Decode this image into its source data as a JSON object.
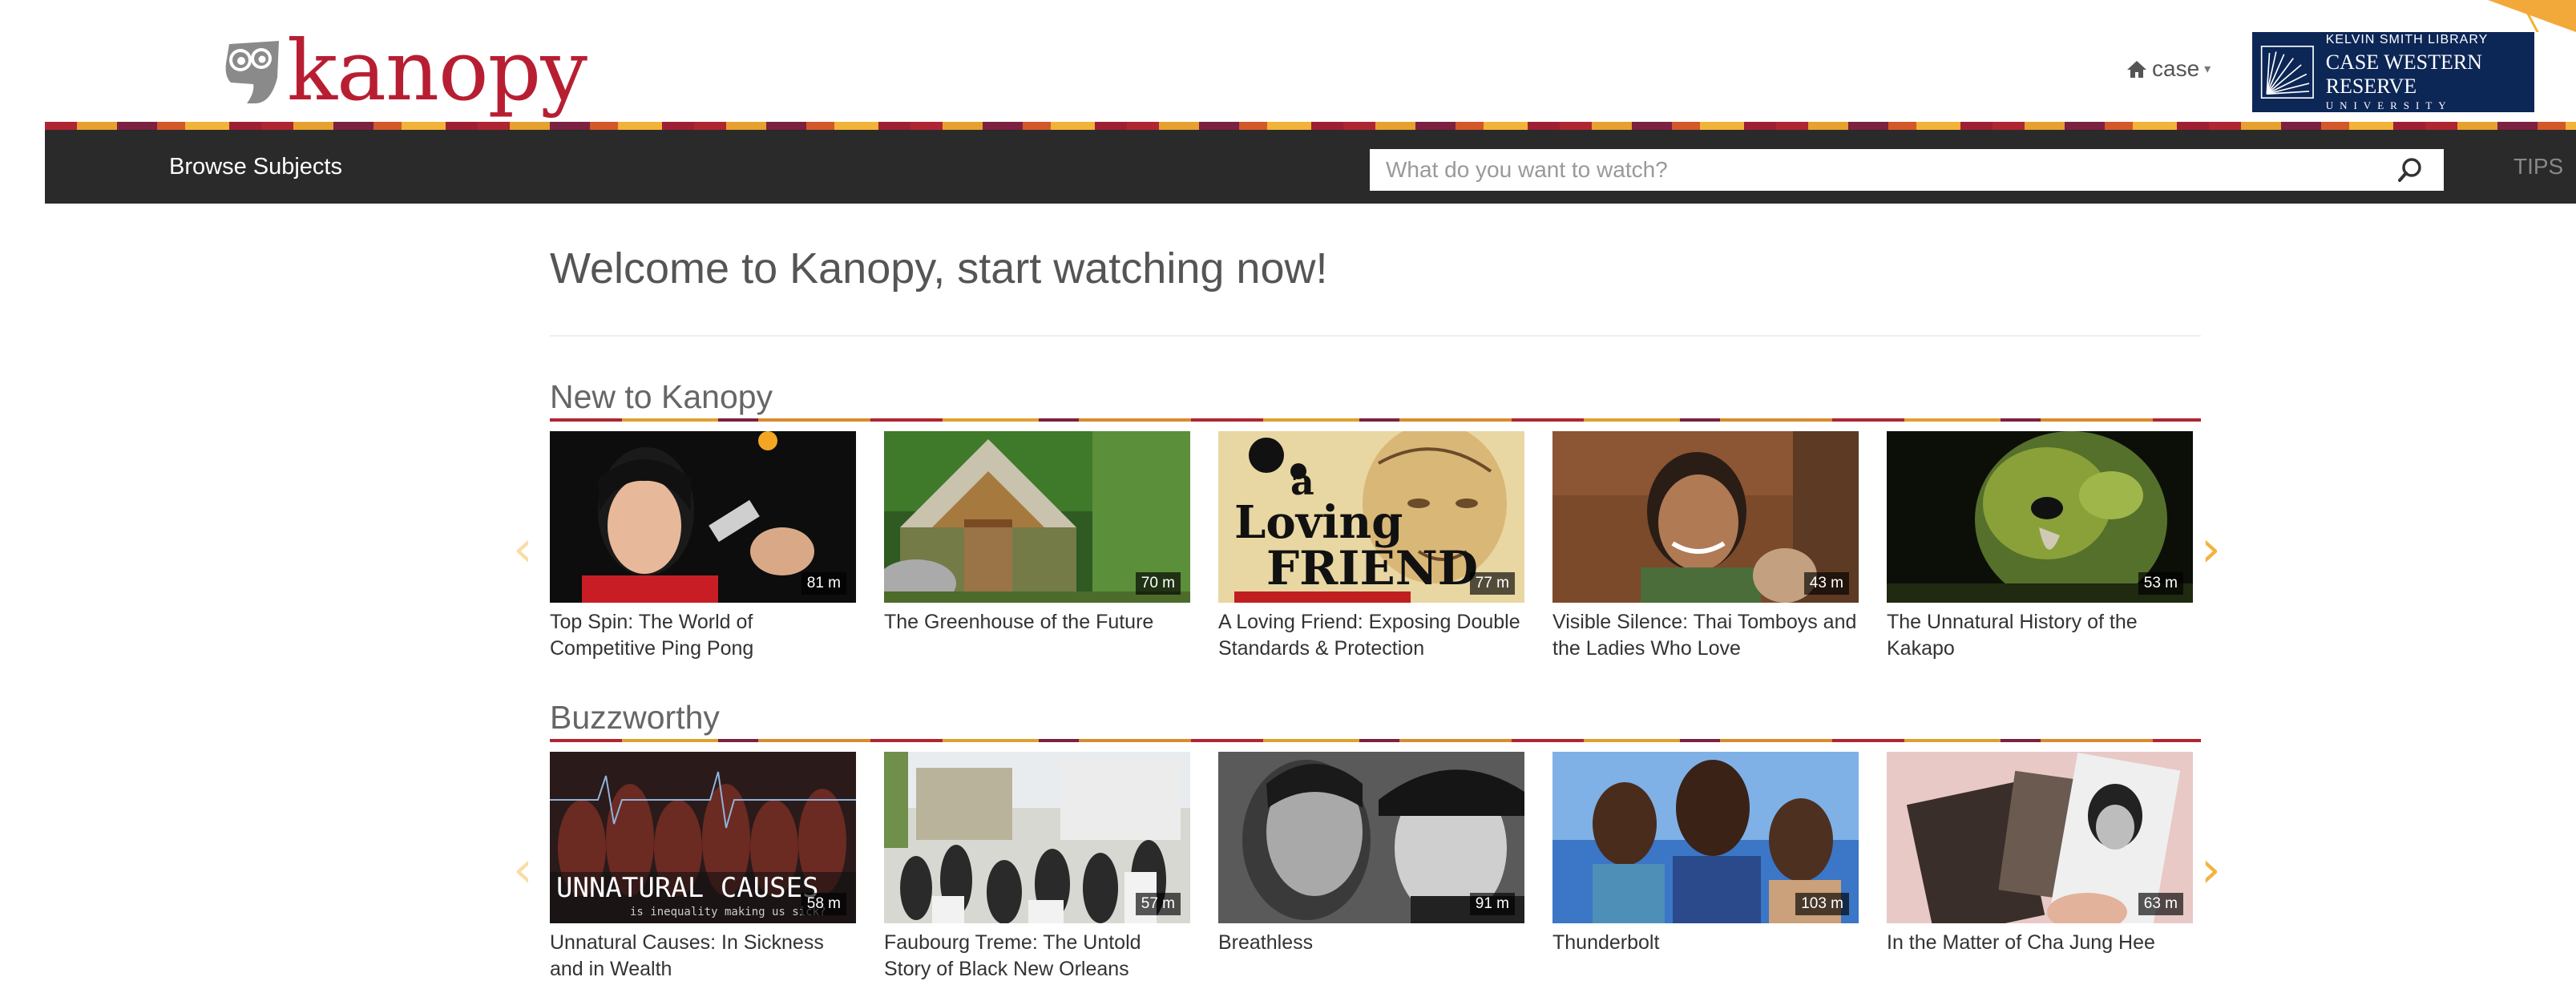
{
  "brand": {
    "name": "kanopy",
    "color": "#b81e32"
  },
  "header": {
    "user_menu": "case",
    "library_badge": {
      "line1": "KELVIN SMITH LIBRARY",
      "line2": "CASE WESTERN RESERVE",
      "line3": "UNIVERSITY"
    }
  },
  "nav": {
    "browse_label": "Browse Subjects",
    "search_placeholder": "What do you want to watch?",
    "tips_label": "TIPS"
  },
  "main": {
    "welcome": "Welcome to Kanopy, start watching now!",
    "rows": [
      {
        "title": "New to Kanopy",
        "items": [
          {
            "title": "Top Spin: The World of Competitive Ping Pong",
            "duration": "81 m",
            "image": "girl-ping-pong"
          },
          {
            "title": "The Greenhouse of the Future",
            "duration": "70 m",
            "image": "greenhouse"
          },
          {
            "title": "A Loving Friend: Exposing Double Standards & Protection",
            "duration": "77 m",
            "image": "poster-a-loving-friend",
            "poster_text": [
              "a",
              "Loving",
              "FRIEND"
            ]
          },
          {
            "title": "Visible Silence: Thai Tomboys and the Ladies Who Love",
            "duration": "43 m",
            "image": "smiling-person"
          },
          {
            "title": "The Unnatural History of the Kakapo",
            "duration": "53 m",
            "image": "kakapo-parrot"
          }
        ]
      },
      {
        "title": "Buzzworthy",
        "items": [
          {
            "title": "Unnatural Causes: In Sickness and in Wealth",
            "duration": "58 m",
            "image": "unnatural-causes-title",
            "poster_text": [
              "UNNATURAL CAUSES",
              "is inequality making us sick?"
            ]
          },
          {
            "title": "Faubourg Treme: The Untold Story of Black New Orleans",
            "duration": "57 m",
            "image": "street-crowd"
          },
          {
            "title": "Breathless",
            "duration": "91 m",
            "image": "black-white-couple"
          },
          {
            "title": "Thunderbolt",
            "duration": "103 m",
            "image": "three-people-poster"
          },
          {
            "title": "In the Matter of Cha Jung Hee",
            "duration": "63 m",
            "image": "old-photos"
          }
        ]
      }
    ]
  },
  "colors": {
    "accent": "#f2b340",
    "navbar": "#2a2a2a",
    "badge": "#0c2656"
  }
}
